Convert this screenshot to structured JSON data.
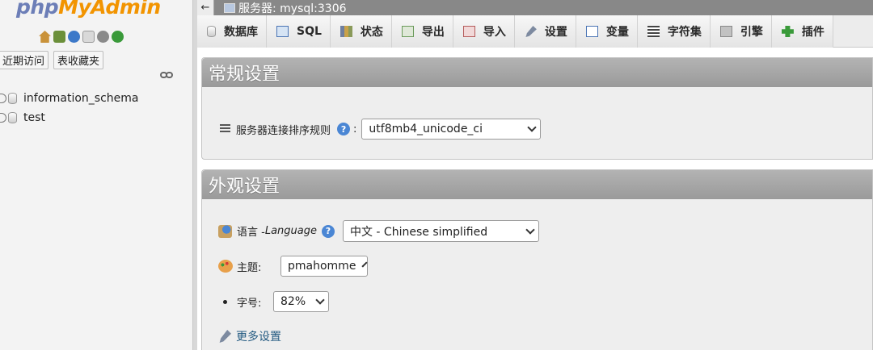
{
  "nav": {
    "logo": {
      "php": "php",
      "my": "My",
      "admin": "Admin"
    },
    "icons": [
      "home-icon",
      "exit-icon",
      "help-icon",
      "documentation-icon",
      "settings-icon",
      "reload-icon"
    ],
    "tabs": [
      "近期访问",
      "表收藏夹"
    ],
    "databases": [
      {
        "name": "information_schema"
      },
      {
        "name": "test"
      }
    ]
  },
  "serverbar": {
    "back": "←",
    "label": "服务器: mysql:3306"
  },
  "menu": [
    {
      "label": "数据库",
      "icon": "database-icon"
    },
    {
      "label": "SQL",
      "icon": "sql-icon"
    },
    {
      "label": "状态",
      "icon": "status-icon"
    },
    {
      "label": "导出",
      "icon": "export-icon"
    },
    {
      "label": "导入",
      "icon": "import-icon"
    },
    {
      "label": "设置",
      "icon": "wrench-icon"
    },
    {
      "label": "变量",
      "icon": "variables-icon"
    },
    {
      "label": "字符集",
      "icon": "charset-icon"
    },
    {
      "label": "引擎",
      "icon": "engine-icon"
    },
    {
      "label": "插件",
      "icon": "plugin-icon"
    }
  ],
  "general": {
    "title": "常规设置",
    "collation_label": "服务器连接排序规则",
    "collation_colon": ":",
    "collation_value": "utf8mb4_unicode_ci"
  },
  "appearance": {
    "title": "外观设置",
    "language_label": "语言 - ",
    "language_label_en": "Language",
    "language_value": "中文 - Chinese simplified",
    "theme_label": "主题:",
    "theme_value": "pmahomme",
    "font_label": "字号:",
    "font_value": "82%",
    "more_settings": "更多设置"
  },
  "colors": {
    "logo_blue": "#6c7eb7",
    "logo_orange": "#f29400",
    "panel_header": "#a6a6a6",
    "link": "#235a81"
  }
}
